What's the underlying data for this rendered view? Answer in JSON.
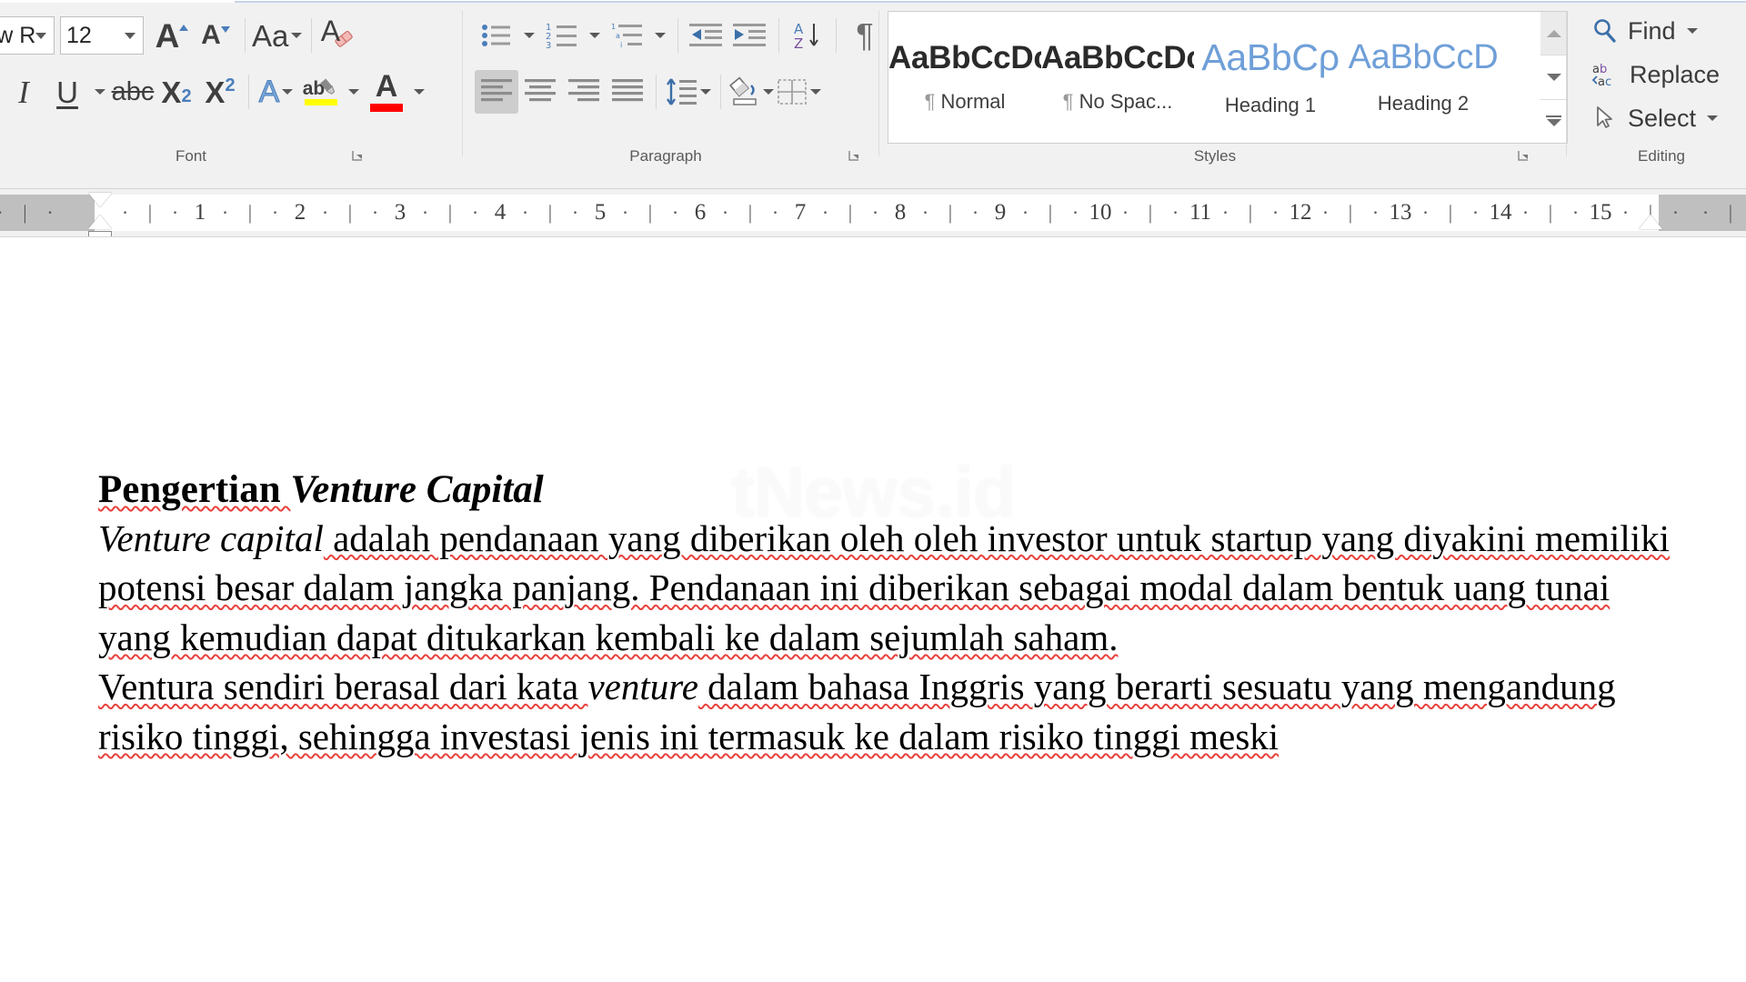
{
  "ribbon": {
    "groups": {
      "font": {
        "label": "Font",
        "font_name": "nes New R",
        "font_size": "12",
        "buttons": {
          "grow_font": "A",
          "shrink_font": "A",
          "change_case": "Aa",
          "clear_formatting": "A",
          "italic": "I",
          "underline": "U",
          "strikethrough": "abc",
          "subscript": "X",
          "subscript_sub": "2",
          "superscript": "X",
          "superscript_sup": "2",
          "text_effects": "A",
          "text_highlight": "ab",
          "font_color": "A"
        }
      },
      "paragraph": {
        "label": "Paragraph",
        "buttons": {
          "bullets": "bullets-icon",
          "numbering": "numbering-icon",
          "multilevel_list": "multilevel-list-icon",
          "decrease_indent": "decrease-indent-icon",
          "increase_indent": "increase-indent-icon",
          "sort": "sort-icon",
          "show_marks": "¶",
          "align_left": "align-left-icon",
          "align_center": "align-center-icon",
          "align_right": "align-right-icon",
          "justify": "justify-icon",
          "line_spacing": "line-spacing-icon",
          "shading": "shading-icon",
          "borders": "borders-icon"
        },
        "sort_letters": {
          "a": "A",
          "z": "Z"
        }
      },
      "styles": {
        "label": "Styles",
        "items": [
          {
            "preview": "AaBbCcDc",
            "name": "Normal",
            "pilcrow": "¶",
            "kind": "bold"
          },
          {
            "preview": "AaBbCcDc",
            "name": "No Spac...",
            "pilcrow": "¶",
            "kind": "bold"
          },
          {
            "preview": "AaBbCρ",
            "name": "Heading 1",
            "pilcrow": "",
            "kind": "blue"
          },
          {
            "preview": "AaBbCcD",
            "name": "Heading 2",
            "pilcrow": "",
            "kind": "blue"
          }
        ]
      },
      "editing": {
        "label": "Editing",
        "items": [
          {
            "label": "Find",
            "icon": "search-icon",
            "has_caret": true
          },
          {
            "label": "Replace",
            "icon": "replace-icon",
            "has_caret": false
          },
          {
            "label": "Select",
            "icon": "cursor-arrow-icon",
            "has_caret": true
          }
        ]
      }
    }
  },
  "ruler": {
    "numbers": [
      "1",
      "2",
      "3",
      "4",
      "5",
      "6",
      "7",
      "8",
      "9",
      "10",
      "11",
      "12",
      "13",
      "14",
      "15"
    ],
    "minor_dot": "·",
    "minor_bar": "|"
  },
  "document": {
    "watermark": "tNews.id",
    "heading": {
      "part1": "Pengertian ",
      "part2": "Venture Capital"
    },
    "paragraph1": {
      "lead_italic": "Venture capital",
      "rest": " adalah pendanaan yang diberikan oleh oleh investor untuk startup yang diyakini memiliki potensi besar dalam jangka panjang. Pendanaan ini diberikan sebagai modal dalam bentuk uang tunai yang kemudian dapat ditukarkan kembali ke dalam sejumlah saham."
    },
    "paragraph2": {
      "before": "Ventura sendiri berasal dari kata ",
      "italic": "venture",
      "after": " dalam bahasa Inggris yang berarti sesuatu yang mengandung risiko tinggi, sehingga investasi jenis ini termasuk ke dalam risiko tinggi meski"
    }
  },
  "colors": {
    "ribbon_bg": "#f1f1f1",
    "accent_blue": "#2b579a",
    "icon_blue": "#4a7ebb",
    "highlight_yellow": "#ffff00",
    "font_color_red": "#ff0000",
    "spell_error_red": "#e8413c",
    "heading_blue": "#6f9fd8"
  }
}
